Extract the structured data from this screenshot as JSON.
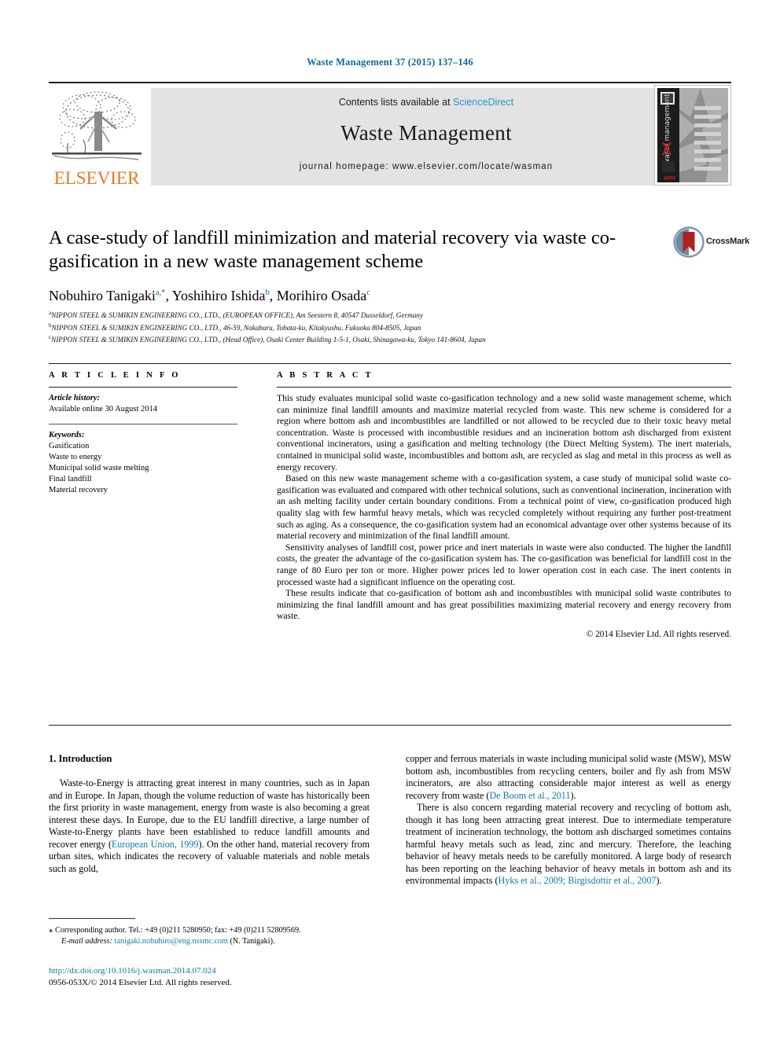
{
  "running_head": "Waste Management 37 (2015) 137–146",
  "masthead": {
    "publisher": "ELSEVIER",
    "contents_prefix": "Contents lists available at",
    "sciencedirect": "ScienceDirect",
    "journal_title": "Waste Management",
    "homepage": "journal homepage: www.elsevier.com/locate/wasman",
    "cover_spine_text": "waste management",
    "cover_badge": "WM",
    "cover_items": [
      "GENERATION",
      "COMPOSITION",
      "DISPOSAL",
      "COLLECTION",
      "RECYCLING",
      "DISPOSAL",
      "ECONOMICS",
      "ANALYSIS"
    ]
  },
  "article": {
    "title": "A case-study of landfill minimization and material recovery via waste co-gasification in a new waste management scheme",
    "crossmark_label": "CrossMark",
    "authors": [
      {
        "name": "Nobuhiro Tanigaki",
        "marks": "a,*"
      },
      {
        "name": "Yoshihiro Ishida",
        "marks": "b"
      },
      {
        "name": "Morihiro Osada",
        "marks": "c"
      }
    ],
    "affiliations": [
      {
        "mark": "a",
        "text": "NIPPON STEEL & SUMIKIN ENGINEERING CO., LTD., (EUROPEAN OFFICE), Am Seestern 8, 40547 Dusseldorf, Germany"
      },
      {
        "mark": "b",
        "text": "NIPPON STEEL & SUMIKIN ENGINEERING CO., LTD., 46-59, Nakabaru, Tobata-ku, Kitakyushu, Fukuoka 804-8505, Japan"
      },
      {
        "mark": "c",
        "text": "NIPPON STEEL & SUMIKIN ENGINEERING CO., LTD., (Head Office), Osaki Center Building 1-5-1, Osaki, Shinagawa-ku, Tokyo 141-8604, Japan"
      }
    ]
  },
  "info": {
    "heading": "A R T I C L E    I N F O",
    "history_label": "Article history:",
    "history_line": "Available online 30 August 2014",
    "keywords_label": "Keywords:",
    "keywords": [
      "Gasification",
      "Waste to energy",
      "Municipal solid waste melting",
      "Final landfill",
      "Material recovery"
    ]
  },
  "abstract": {
    "heading": "A B S T R A C T",
    "paragraphs": [
      "This study evaluates municipal solid waste co-gasification technology and a new solid waste management scheme, which can minimize final landfill amounts and maximize material recycled from waste. This new scheme is considered for a region where bottom ash and incombustibles are landfilled or not allowed to be recycled due to their toxic heavy metal concentration. Waste is processed with incombustible residues and an incineration bottom ash discharged from existent conventional incinerators, using a gasification and melting technology (the Direct Melting System). The inert materials, contained in municipal solid waste, incombustibles and bottom ash, are recycled as slag and metal in this process as well as energy recovery.",
      "Based on this new waste management scheme with a co-gasification system, a case study of municipal solid waste co-gasification was evaluated and compared with other technical solutions, such as conventional incineration, incineration with an ash melting facility under certain boundary conditions. From a technical point of view, co-gasification produced high quality slag with few harmful heavy metals, which was recycled completely without requiring any further post-treatment such as aging. As a consequence, the co-gasification system had an economical advantage over other systems because of its material recovery and minimization of the final landfill amount.",
      "Sensitivity analyses of landfill cost, power price and inert materials in waste were also conducted. The higher the landfill costs, the greater the advantage of the co-gasification system has. The co-gasification was beneficial for landfill cost in the range of 80 Euro per ton or more. Higher power prices led to lower operation cost in each case. The inert contents in processed waste had a significant influence on the operating cost.",
      "These results indicate that co-gasification of bottom ash and incombustibles with municipal solid waste contributes to minimizing the final landfill amount and has great possibilities maximizing material recovery and energy recovery from waste."
    ],
    "copyright": "© 2014 Elsevier Ltd. All rights reserved."
  },
  "body": {
    "section_heading": "1. Introduction",
    "left_paragraph_1_a": "Waste-to-Energy is attracting great interest in many countries, such as in Japan and in Europe. In Japan, though the volume reduction of waste has historically been the first priority in waste management, energy from waste is also becoming a great interest these days. In Europe, due to the EU landfill directive, a large number of Waste-to-Energy plants have been established to reduce landfill amounts and recover energy (",
    "left_citation_1": "European Union, 1999",
    "left_paragraph_1_b": "). On the other hand, material recovery from urban sites, which indicates the recovery of valuable materials and noble metals such as gold,",
    "right_paragraph_1_a": "copper and ferrous materials in waste including municipal solid waste (MSW), MSW bottom ash, incombustibles from recycling centers, boiler and fly ash from MSW incinerators, are also attracting considerable major interest as well as energy recovery from waste (",
    "right_citation_1": "De Boom et al., 2011",
    "right_paragraph_1_b": ").",
    "right_paragraph_2_a": "There is also concern regarding material recovery and recycling of bottom ash, though it has long been attracting great interest. Due to intermediate temperature treatment of incineration technology, the bottom ash discharged sometimes contains harmful heavy metals such as lead, zinc and mercury. Therefore, the leaching behavior of heavy metals needs to be carefully monitored. A large body of research has been reporting on the leaching behavior of heavy metals in bottom ash and its environmental impacts (",
    "right_citation_2": "Hyks et al., 2009; Birgisdottir et al., 2007",
    "right_paragraph_2_b": ")."
  },
  "footnote": {
    "corresponding": "Corresponding author. Tel.: +49 (0)211 5280950; fax: +49 (0)211 52809569.",
    "email_label": "E-mail address:",
    "email": "tanigaki.nobuhiro@eng.nssmc.com",
    "email_suffix": "(N. Tanigaki).",
    "doi": "http://dx.doi.org/10.1016/j.wasman.2014.07.024",
    "issn_line": "0956-053X/© 2014 Elsevier Ltd. All rights reserved."
  },
  "colors": {
    "journal_blue": "#0b6a9c",
    "link_blue": "#0b7ca8",
    "elsevier_orange": "#e87722",
    "band_gray": "#e3e3e3",
    "crossmark_red": "#b0201f"
  }
}
